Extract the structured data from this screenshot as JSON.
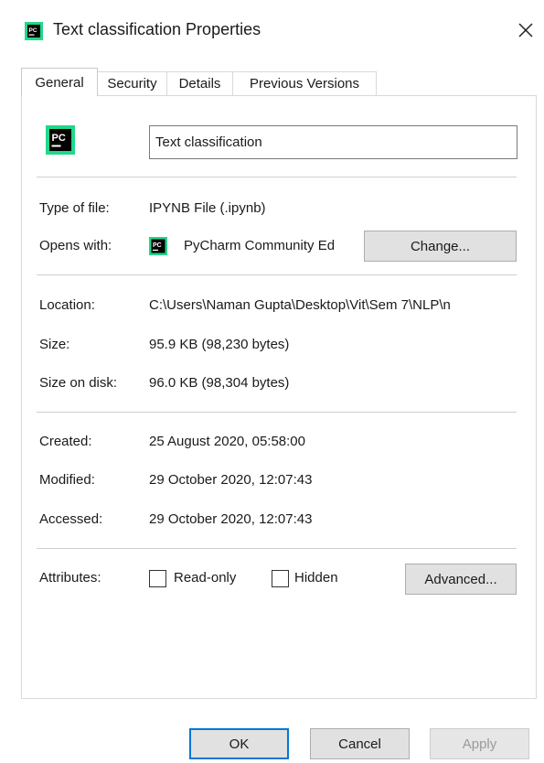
{
  "window": {
    "title": "Text classification Properties",
    "app_icon": "pycharm-icon",
    "close_icon": "close-icon"
  },
  "tabs": [
    {
      "label": "General",
      "active": true
    },
    {
      "label": "Security",
      "active": false
    },
    {
      "label": "Details",
      "active": false
    },
    {
      "label": "Previous Versions",
      "active": false
    }
  ],
  "general": {
    "file_name": "Text classification",
    "type_of_file_label": "Type of file:",
    "type_of_file_value": "IPYNB File (.ipynb)",
    "opens_with_label": "Opens with:",
    "opens_with_value": "PyCharm Community Ed",
    "change_button": "Change...",
    "location_label": "Location:",
    "location_value": "C:\\Users\\Naman Gupta\\Desktop\\Vit\\Sem 7\\NLP\\n",
    "size_label": "Size:",
    "size_value": "95.9 KB (98,230 bytes)",
    "size_on_disk_label": "Size on disk:",
    "size_on_disk_value": "96.0 KB (98,304 bytes)",
    "created_label": "Created:",
    "created_value": "25 August 2020, 05:58:00",
    "modified_label": "Modified:",
    "modified_value": "29 October 2020, 12:07:43",
    "accessed_label": "Accessed:",
    "accessed_value": "29 October 2020, 12:07:43",
    "attributes_label": "Attributes:",
    "read_only_label": "Read-only",
    "read_only_checked": false,
    "hidden_label": "Hidden",
    "hidden_checked": false,
    "advanced_button": "Advanced..."
  },
  "footer": {
    "ok_button": "OK",
    "cancel_button": "Cancel",
    "apply_button": "Apply"
  },
  "colors": {
    "accent": "#0078d7",
    "button_face": "#e1e1e1",
    "pycharm_green": "#21d789",
    "icon_black": "#000000"
  }
}
